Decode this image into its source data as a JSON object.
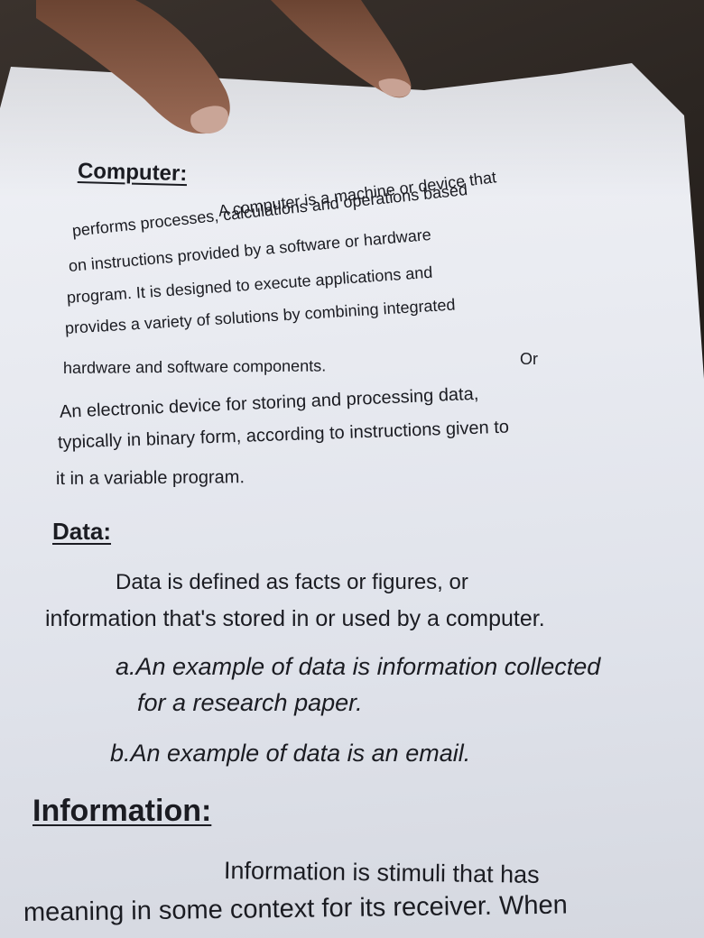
{
  "computer": {
    "heading": "Computer:",
    "definition_lines": [
      "A computer is a machine or device that",
      "performs processes, calculations and operations based",
      "on instructions provided by a software or hardware",
      "program. It is designed to execute applications and",
      "provides a variety of solutions by combining integrated",
      "hardware and software components."
    ],
    "or_label": "Or",
    "alt_definition_lines": [
      "An electronic device for storing and processing data,",
      "typically in binary form, according to instructions given to",
      "it in a variable program."
    ]
  },
  "data": {
    "heading": "Data:",
    "definition_lines": [
      "Data is defined as facts or figures, or",
      "information that's stored in or used by a computer."
    ],
    "examples": [
      "a.An example of data is information collected",
      "for a research paper.",
      "b.An example of data is an email."
    ]
  },
  "information": {
    "heading": "Information:",
    "definition_lines": [
      "Information is stimuli that has",
      "meaning in some context for its receiver. When"
    ]
  }
}
